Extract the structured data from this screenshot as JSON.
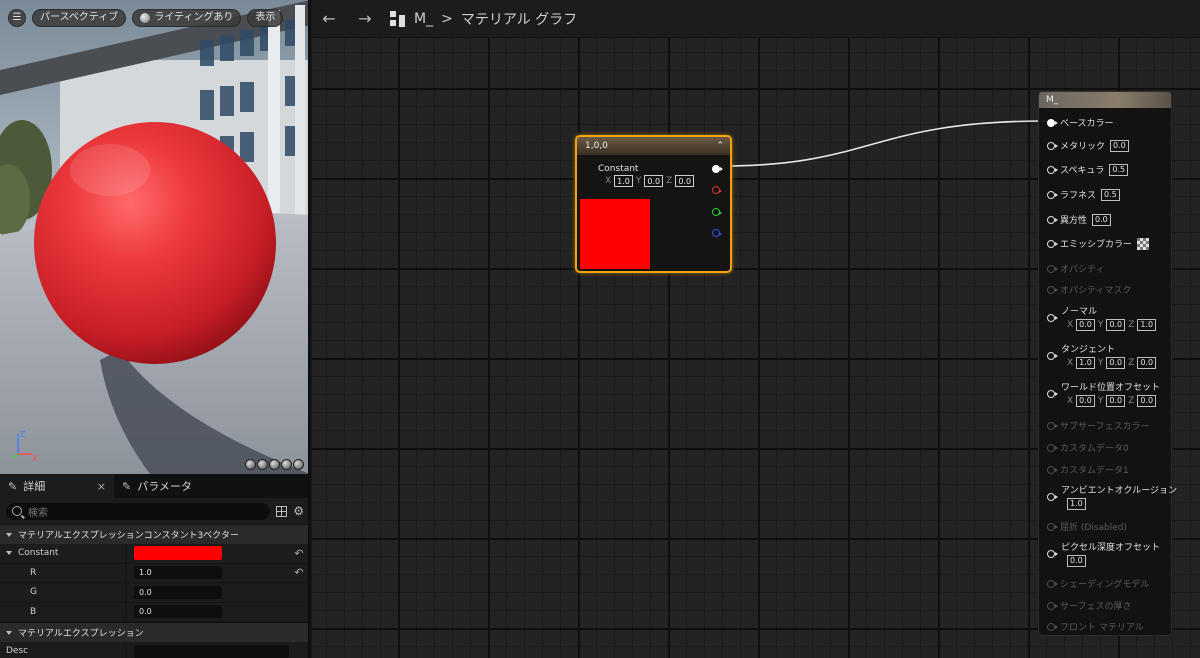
{
  "viewport": {
    "menu_icon": "hamburger-icon",
    "perspective_label": "パースペクティブ",
    "lighting_label": "ライティングあり",
    "show_label": "表示",
    "axis_labels": {
      "z": "Z",
      "x": "X"
    }
  },
  "details": {
    "tab_details": "詳細",
    "tab_close": "×",
    "tab_parameters": "パラメータ",
    "search_placeholder": "検索",
    "section1": "マテリアルエクスプレッションコンスタント3ベクター",
    "constant_label": "Constant",
    "constant_color": "#ff0000",
    "r_label": "R",
    "r_value": "1.0",
    "g_label": "G",
    "g_value": "0.0",
    "b_label": "B",
    "b_value": "0.0",
    "section2": "マテリアルエクスプレッション",
    "desc_label": "Desc",
    "reset_glyph": "↶"
  },
  "graph": {
    "back_arrow": "←",
    "forward_arrow": "→",
    "crumb_material": "M_",
    "crumb_sep": ">",
    "crumb_title": "マテリアル グラフ",
    "constant_node": {
      "header": "1,0,0",
      "title": "Constant",
      "x": "1.0",
      "y": "0.0",
      "z": "0.0",
      "x_label": "X",
      "y_label": "Y",
      "z_label": "Z",
      "collapse_glyph": "^",
      "swatch_color": "#ff0000"
    },
    "result_node": {
      "header": "M_",
      "inputs": [
        {
          "label": "ベースカラー",
          "enabled": true,
          "connected": true
        },
        {
          "label": "メタリック",
          "value": "0.0",
          "enabled": true
        },
        {
          "label": "スペキュラ",
          "value": "0.5",
          "enabled": true
        },
        {
          "label": "ラフネス",
          "value": "0.5",
          "enabled": true
        },
        {
          "label": "異方性",
          "value": "0.0",
          "enabled": true
        },
        {
          "label": "エミッシブカラー",
          "checker": true,
          "enabled": true
        },
        {
          "label": "オパシティ",
          "enabled": false
        },
        {
          "label": "オパシティマスク",
          "enabled": false
        }
      ],
      "vectors": [
        {
          "label": "ノーマル",
          "x": "0.0",
          "y": "0.0",
          "z": "1.0"
        },
        {
          "label": "タンジェント",
          "x": "1.0",
          "y": "0.0",
          "z": "0.0"
        },
        {
          "label": "ワールド位置オフセット",
          "x": "0.0",
          "y": "0.0",
          "z": "0.0"
        }
      ],
      "disabled_mid": [
        {
          "label": "サブサーフェスカラー"
        },
        {
          "label": "カスタムデータ0"
        },
        {
          "label": "カスタムデータ1"
        }
      ],
      "ao": {
        "label": "アンビエントオクルージョン",
        "value": "1.0"
      },
      "refraction": {
        "label": "屈折 (Disabled)"
      },
      "pdo": {
        "label": "ピクセル深度オフセット",
        "value": "0.0"
      },
      "disabled_end": [
        {
          "label": "シェーディングモデル"
        },
        {
          "label": "サーフェスの厚さ"
        },
        {
          "label": "フロント マテリアル"
        }
      ]
    }
  }
}
